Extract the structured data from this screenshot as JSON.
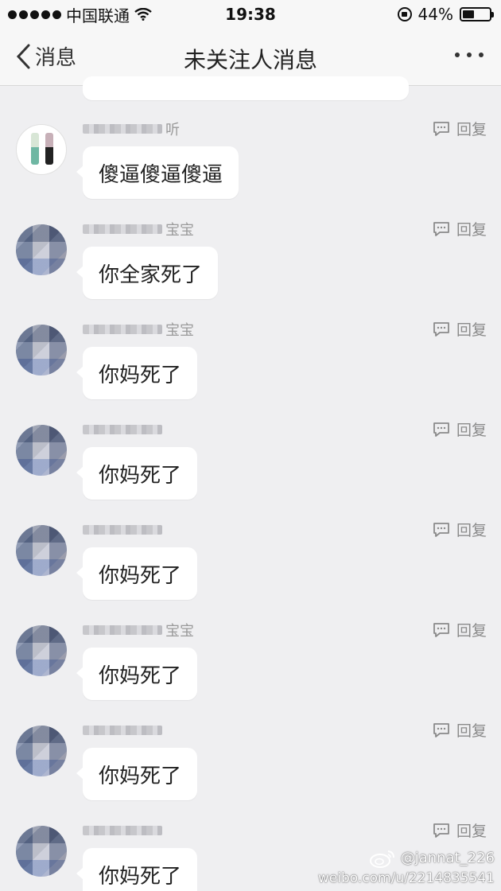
{
  "status_bar": {
    "carrier": "中国联通",
    "time": "19:38",
    "battery_percent": "44%",
    "battery_level": 0.44
  },
  "nav": {
    "back_label": "消息",
    "title": "未关注人消息"
  },
  "messages": [
    {
      "name_tail": "听",
      "text": "傻逼傻逼傻逼",
      "reply_label": "回复"
    },
    {
      "name_tail": "宝宝",
      "text": "你全家死了",
      "reply_label": "回复"
    },
    {
      "name_tail": "宝宝",
      "text": "你妈死了",
      "reply_label": "回复"
    },
    {
      "name_tail": "",
      "text": "你妈死了",
      "reply_label": "回复"
    },
    {
      "name_tail": "",
      "text": "你妈死了",
      "reply_label": "回复"
    },
    {
      "name_tail": "宝宝",
      "text": "你妈死了",
      "reply_label": "回复"
    },
    {
      "name_tail": "",
      "text": "你妈死了",
      "reply_label": "回复"
    },
    {
      "name_tail": "",
      "text": "你妈死了",
      "reply_label": "回复"
    }
  ],
  "watermark": {
    "handle": "@jannat_226",
    "url": "weibo.com/u/2214835541"
  },
  "colors": {
    "background": "#efeff1",
    "bubble": "#ffffff",
    "secondary_text": "#8a8a8a"
  }
}
